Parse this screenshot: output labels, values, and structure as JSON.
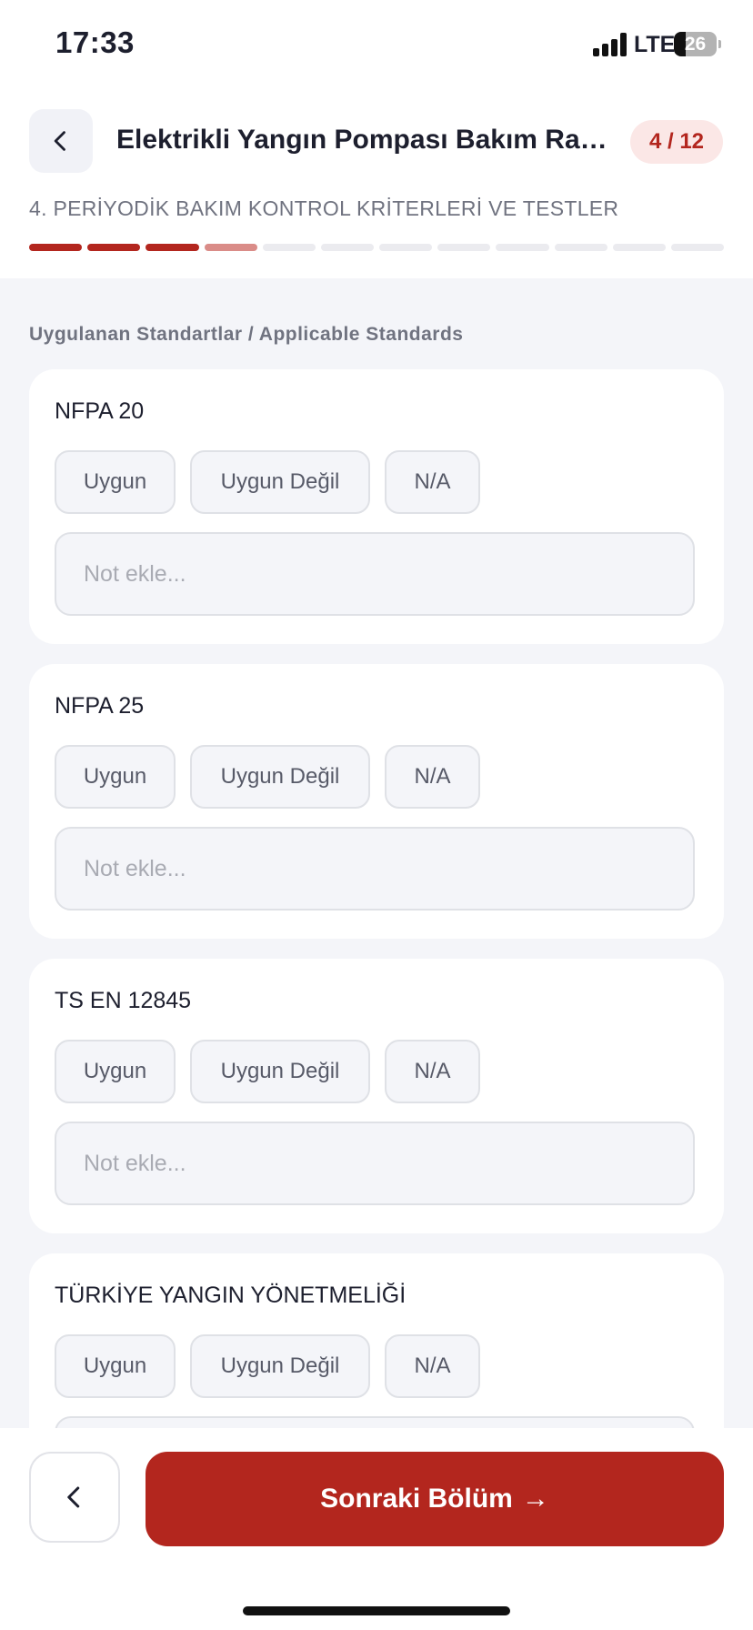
{
  "status_bar": {
    "time": "17:33",
    "network": "LTE",
    "battery": "26"
  },
  "header": {
    "title": "Elektrikli Yangın Pompası Bakım Raporu",
    "step_badge": "4 / 12",
    "section_title": "4. PERİYODİK BAKIM KONTROL KRİTERLERİ VE TESTLER",
    "progress": {
      "total_steps": 12,
      "current_step": 4
    }
  },
  "content": {
    "group_label": "Uygulanan Standartlar / Applicable Standards",
    "options": {
      "ok": "Uygun",
      "not_ok": "Uygun Değil",
      "na": "N/A"
    },
    "note_placeholder": "Not ekle...",
    "items": [
      {
        "title": "NFPA 20"
      },
      {
        "title": "NFPA 25"
      },
      {
        "title": "TS EN 12845"
      },
      {
        "title": "TÜRKİYE YANGIN YÖNETMELİĞİ"
      }
    ]
  },
  "footer": {
    "next_label": "Sonraki Bölüm",
    "next_arrow": "→"
  },
  "colors": {
    "accent": "#b3261e",
    "accent_light": "#da8c88",
    "badge_bg": "#fbe7e6",
    "page_bg": "#f4f5f9"
  },
  "icons": {
    "back": "chevron-left-icon",
    "prev": "chevron-left-icon",
    "next": "arrow-right-icon"
  }
}
